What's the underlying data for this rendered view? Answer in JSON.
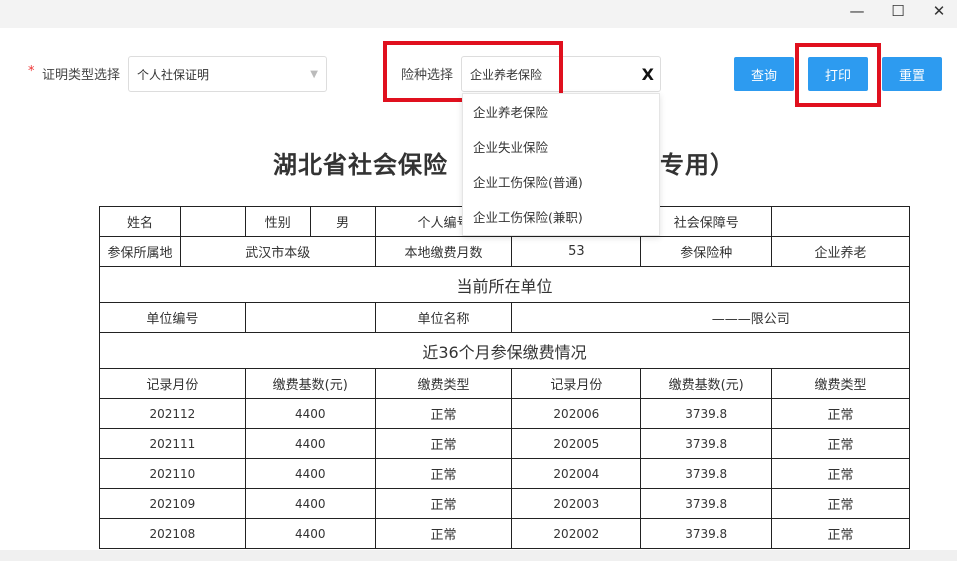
{
  "window": {
    "minimize": "—",
    "maximize": "☐",
    "close": "✕"
  },
  "filters": {
    "cert_type_required": "*",
    "cert_type_label": "证明类型选择",
    "cert_type_value": "个人社保证明",
    "insurance_label": "险种选择",
    "insurance_value": "企业养老保险",
    "clear_icon": "X"
  },
  "buttons": {
    "query": "查询",
    "print": "打印",
    "reset": "重置"
  },
  "dropdown_options": [
    "企业养老保险",
    "企业失业保险",
    "企业工伤保险(普通)",
    "企业工伤保险(兼职)"
  ],
  "title_left": "湖北省社会保险",
  "title_right": "专用）",
  "info": {
    "name_label": "姓名",
    "name_value": "",
    "gender_label": "性别",
    "gender_value": "男",
    "id_label": "个人编号",
    "id_value": "",
    "ssn_label": "社会保障号",
    "ssn_value": "",
    "region_label": "参保所属地",
    "region_value": "武汉市本级",
    "months_label": "本地缴费月数",
    "months_value": "53",
    "type_label": "参保险种",
    "type_value": "企业养老"
  },
  "unit_section": "当前所在单位",
  "unit": {
    "code_label": "单位编号",
    "code_value": "",
    "name_label": "单位名称",
    "name_value": "———限公司"
  },
  "pay_section": "近36个月参保缴费情况",
  "pay_headers": [
    "记录月份",
    "缴费基数(元)",
    "缴费类型",
    "记录月份",
    "缴费基数(元)",
    "缴费类型"
  ],
  "pay_rows": [
    [
      "202112",
      "4400",
      "正常",
      "202006",
      "3739.8",
      "正常"
    ],
    [
      "202111",
      "4400",
      "正常",
      "202005",
      "3739.8",
      "正常"
    ],
    [
      "202110",
      "4400",
      "正常",
      "202004",
      "3739.8",
      "正常"
    ],
    [
      "202109",
      "4400",
      "正常",
      "202003",
      "3739.8",
      "正常"
    ],
    [
      "202108",
      "4400",
      "正常",
      "202002",
      "3739.8",
      "正常"
    ]
  ],
  "colors": {
    "primary": "#2d9bf0",
    "highlight": "#e0101e"
  }
}
